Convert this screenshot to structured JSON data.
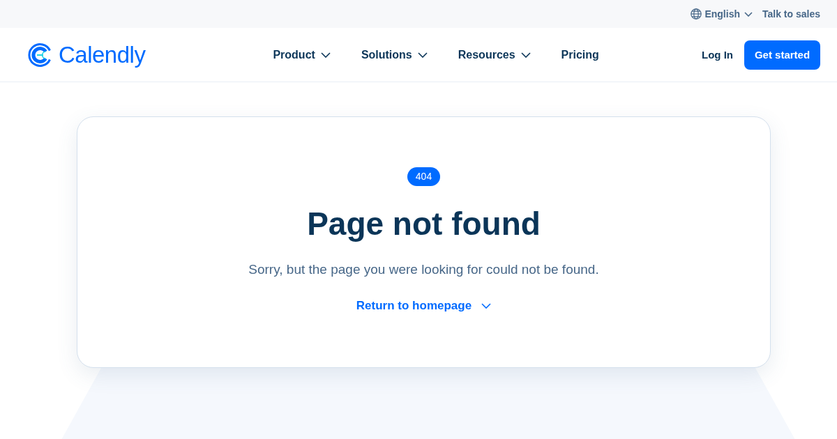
{
  "top_bar": {
    "language": {
      "label": "English"
    },
    "links": [
      "Talk to sales"
    ]
  },
  "nav": {
    "logo": {
      "text": "Calendly"
    },
    "items": [
      {
        "label": "Product",
        "has_menu": true
      },
      {
        "label": "Solutions",
        "has_menu": true
      },
      {
        "label": "Resources",
        "has_menu": true
      },
      {
        "label": "Pricing",
        "has_menu": false
      }
    ],
    "login": "Log In",
    "cta": "Get started"
  },
  "card": {
    "badge": "404",
    "title": "Page not found",
    "message": "Sorry, but the page you were looking for could not be found.",
    "link": {
      "label": "Return to homepage"
    }
  }
}
